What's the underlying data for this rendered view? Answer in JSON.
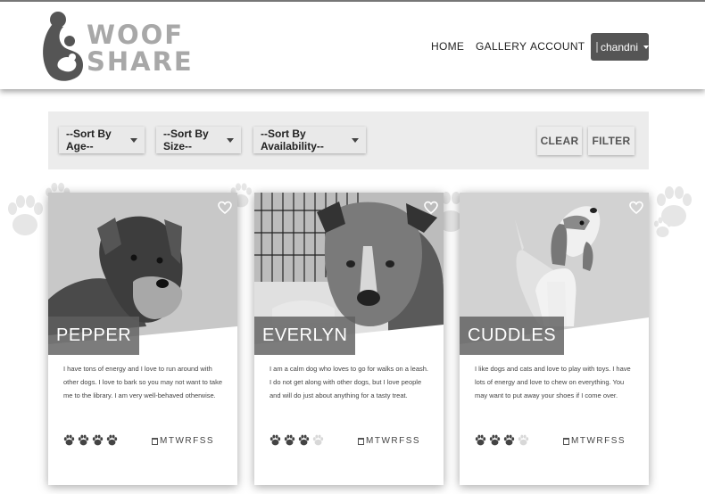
{
  "brand": {
    "line1": "WOOF",
    "line2": "SHARE"
  },
  "nav": {
    "home": "HOME",
    "gallery": "GALLERY",
    "account": "ACCOUNT"
  },
  "user": {
    "name": "chandni"
  },
  "filters": {
    "sort_age": "--Sort By Age--",
    "sort_size": "--Sort By Size--",
    "sort_availability": "--Sort By Availability--",
    "clear": "CLEAR",
    "filter": "FILTER"
  },
  "dogs": [
    {
      "name": "PEPPER",
      "description": "I have tons of energy and I love to run around with other dogs. I love to bark so you may not want to take me to the library. I am very well-behaved otherwise.",
      "rating": 4,
      "rating_max": 4,
      "days": "MTWRFSS"
    },
    {
      "name": "EVERLYN",
      "description": "I am a calm dog who loves to go for walks on a leash. I do not get along with other dogs, but I love people and will do just about anything for a tasty treat.",
      "rating": 3,
      "rating_max": 4,
      "days": "MTWRFSS"
    },
    {
      "name": "CUDDLES",
      "description": "I like dogs and cats and love to play with toys. I have lots of energy and love to chew on everything. You may want to put away your shoes if I come over.",
      "rating": 3,
      "rating_max": 4,
      "days": "MTWRFSS"
    }
  ]
}
